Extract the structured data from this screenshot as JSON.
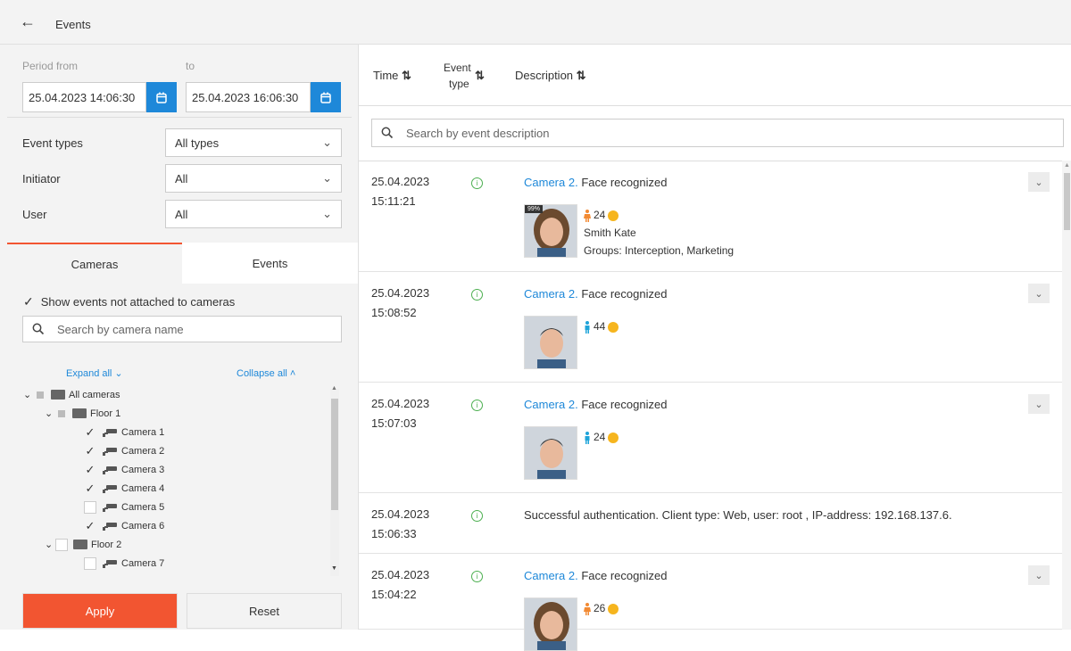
{
  "header": {
    "title": "Events"
  },
  "filters": {
    "period_from_label": "Period from",
    "period_to_label": "to",
    "date_from": "25.04.2023 14:06:30",
    "date_to": "25.04.2023 16:06:30",
    "event_types_label": "Event types",
    "event_types_value": "All types",
    "initiator_label": "Initiator",
    "initiator_value": "All",
    "user_label": "User",
    "user_value": "All"
  },
  "tabs": {
    "cameras": "Cameras",
    "events": "Events"
  },
  "cameras_panel": {
    "show_unattached_label": "Show events not attached to cameras",
    "search_placeholder": "Search by camera name",
    "expand_all": "Expand all",
    "collapse_all": "Collapse all",
    "tree": {
      "root": "All cameras",
      "floor1": "Floor 1",
      "floor1_cameras": [
        {
          "name": "Camera 1",
          "checked": true
        },
        {
          "name": "Camera 2",
          "checked": true
        },
        {
          "name": "Camera 3",
          "checked": true
        },
        {
          "name": "Camera 4",
          "checked": true
        },
        {
          "name": "Camera 5",
          "checked": false
        },
        {
          "name": "Camera 6",
          "checked": true
        }
      ],
      "floor2": "Floor 2",
      "floor2_cameras": [
        {
          "name": "Camera 7",
          "checked": false
        }
      ]
    }
  },
  "buttons": {
    "apply": "Apply",
    "reset": "Reset"
  },
  "table": {
    "col_time": "Time",
    "col_event_type_1": "Event",
    "col_event_type_2": "type",
    "col_description": "Description",
    "search_placeholder": "Search by event description"
  },
  "events": [
    {
      "date": "25.04.2023",
      "time": "15:11:21",
      "camera": "Camera 2.",
      "desc": "Face recognized",
      "gender": "female",
      "age": "24",
      "name": "Smith Kate",
      "groups": "Groups: Interception,  Marketing",
      "badge": "99%"
    },
    {
      "date": "25.04.2023",
      "time": "15:08:52",
      "camera": "Camera 2.",
      "desc": "Face recognized",
      "gender": "male",
      "age": "44"
    },
    {
      "date": "25.04.2023",
      "time": "15:07:03",
      "camera": "Camera 2.",
      "desc": "Face recognized",
      "gender": "male",
      "age": "24"
    },
    {
      "date": "25.04.2023",
      "time": "15:06:33",
      "desc": "Successful authentication. Client type: Web, user: root , IP-address: 192.168.137.6."
    },
    {
      "date": "25.04.2023",
      "time": "15:04:22",
      "camera": "Camera 2.",
      "desc": "Face recognized",
      "gender": "female",
      "age": "26"
    }
  ],
  "colors": {
    "accent": "#1e88d9",
    "apply": "#f25531",
    "female": "#f28a33",
    "male": "#1ea4d9",
    "smile": "#f6b51e",
    "ok": "#4caf50"
  }
}
